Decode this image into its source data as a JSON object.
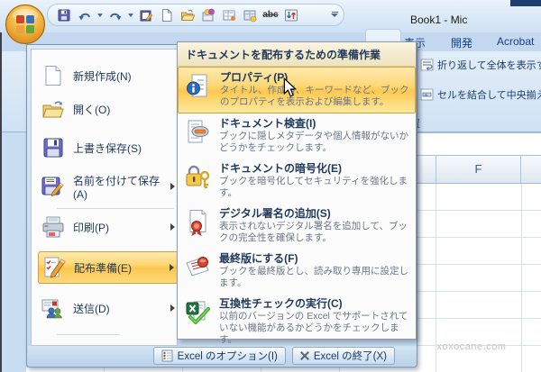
{
  "window": {
    "title": "Book1 - Mic"
  },
  "qat": {
    "abc_label": "abc",
    "icons": [
      "save-icon",
      "undo-icon",
      "redo-icon",
      "edit-sheet-icon",
      "new-document-icon",
      "open-icon",
      "comment-balloons-icon",
      "table-icon",
      "table-badge-icon",
      "strikethrough-icon",
      "sort-icon",
      "customize-qat-icon"
    ]
  },
  "ribbon": {
    "tabs": [
      "表示",
      "開発",
      "Acrobat"
    ],
    "wrap_text_label": "折り返して全体を表示す",
    "merge_center_label": "セルを結合して中央揃え",
    "group_label": "置"
  },
  "sheet": {
    "column_header": "F"
  },
  "watermark": "xoxocane.com",
  "office_menu": {
    "items": [
      {
        "label": "新規作成(N)"
      },
      {
        "label": "開く(O)"
      },
      {
        "label": "上書き保存(S)"
      },
      {
        "label": "名前を付けて保存(A)"
      },
      {
        "label": "印刷(P)"
      },
      {
        "label": "配布準備(E)"
      },
      {
        "label": "送信(D)"
      }
    ],
    "footer": {
      "options_label": "Excel のオプション(I)",
      "exit_label": "Excel の終了(X)"
    }
  },
  "submenu": {
    "header": "ドキュメントを配布するための準備作業",
    "items": [
      {
        "title": "プロパティ(P)",
        "desc": "タイトル、作成者、キーワードなど、ブックのプロパティを表示および編集します。"
      },
      {
        "title": "ドキュメント検査(I)",
        "desc": "ブックに隠しメタデータや個人情報がないかどうかをチェックします。"
      },
      {
        "title": "ドキュメントの暗号化(E)",
        "desc": "ブックを暗号化してセキュリティを強化します。"
      },
      {
        "title": "デジタル署名の追加(S)",
        "desc": "表示されないデジタル署名を追加して、ブックの完全性を確保します。"
      },
      {
        "title": "最終版にする(F)",
        "desc": "ブックを最終版とし、読み取り専用に設定します。"
      },
      {
        "title": "互換性チェックの実行(C)",
        "desc": "以前のバージョンの Excel でサポートされていない機能があるかどうかをチェックします。"
      }
    ]
  },
  "colors": {
    "highlight_orange": "#FBC84F",
    "accent_blue": "#15428B",
    "header_cream": "#EFE3BE"
  }
}
